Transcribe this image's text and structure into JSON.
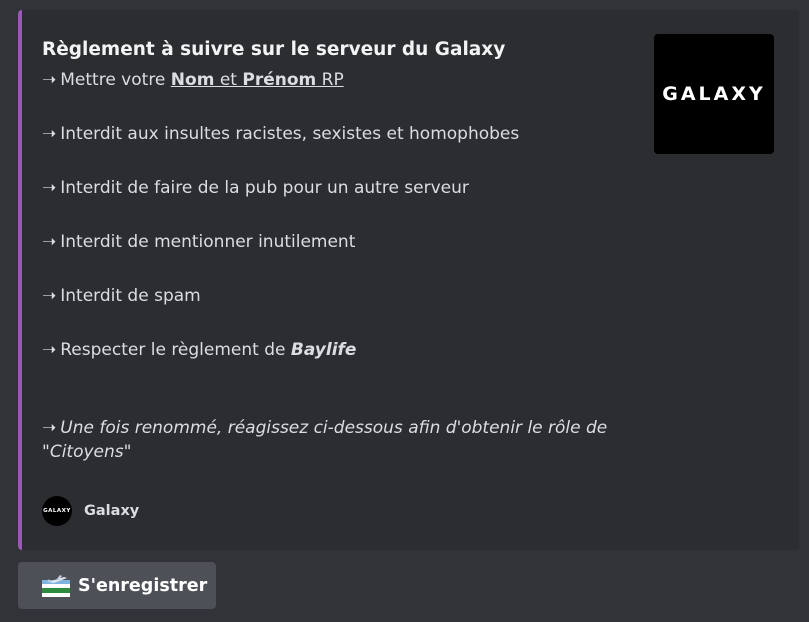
{
  "embed": {
    "accent_color": "#9b59b6",
    "title": "Règlement à suivre sur le serveur du Galaxy",
    "arrow": "➝",
    "rules": {
      "r1_prefix": "Mettre votre ",
      "r1_nom": "Nom",
      "r1_et": " et ",
      "r1_prenom": "Prénom",
      "r1_rp": " RP",
      "r2": "Interdit aux insultes racistes, sexistes et homophobes",
      "r3": "Interdit de faire de la pub pour un autre serveur",
      "r4": "Interdit de mentionner inutilement",
      "r5": "Interdit de spam",
      "r6_prefix": "Respecter le règlement de ",
      "r6_bold": "Baylife"
    },
    "final_note": "Une fois renommé, réagissez ci-dessous afin d'obtenir le rôle de \"Citoyens\"",
    "thumbnail_text": "GALAXY",
    "footer": {
      "avatar_text": "GALAXY",
      "name": "Galaxy"
    }
  },
  "button": {
    "icon": "airplane-flag-emoji-icon",
    "label": "S'enregistrer"
  }
}
